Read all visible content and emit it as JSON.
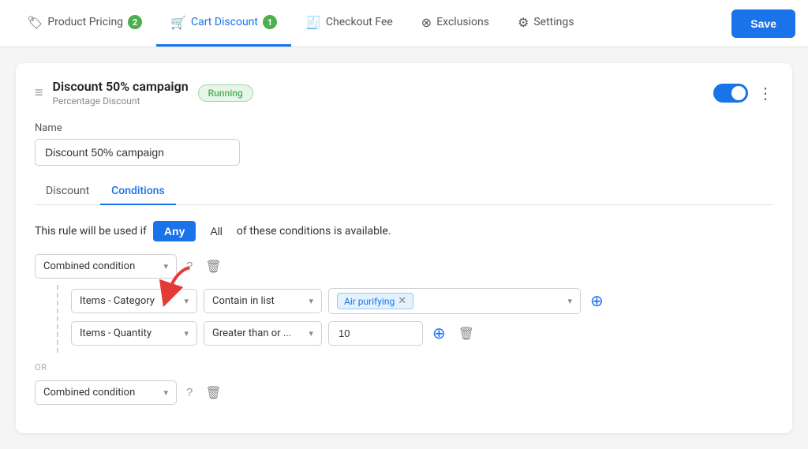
{
  "nav": {
    "tabs": [
      {
        "id": "product-pricing",
        "label": "Product Pricing",
        "icon": "🏷",
        "badge": "2",
        "active": false
      },
      {
        "id": "cart-discount",
        "label": "Cart Discount",
        "icon": "🛒",
        "badge": "1",
        "active": true
      },
      {
        "id": "checkout-fee",
        "label": "Checkout Fee",
        "icon": "🧾",
        "badge": null,
        "active": false
      },
      {
        "id": "exclusions",
        "label": "Exclusions",
        "icon": "⊗",
        "badge": null,
        "active": false
      },
      {
        "id": "settings",
        "label": "Settings",
        "icon": "⚙",
        "badge": null,
        "active": false
      }
    ],
    "save_label": "Save"
  },
  "card": {
    "title": "Discount 50% campaign",
    "subtitle": "Percentage Discount",
    "status": "Running",
    "toggle_on": true
  },
  "form": {
    "name_label": "Name",
    "name_value": "Discount 50% campaign"
  },
  "sub_tabs": [
    {
      "id": "discount",
      "label": "Discount",
      "active": false
    },
    {
      "id": "conditions",
      "label": "Conditions",
      "active": true
    }
  ],
  "conditions": {
    "rule_prefix": "This rule will be used if",
    "any_label": "Any",
    "all_label": "All",
    "rule_suffix": "of these conditions is available.",
    "combined_label": "Combined condition",
    "or_label": "OR",
    "sub_conditions": [
      {
        "field": "Items - Category",
        "operator": "Contain in list",
        "value_type": "tag",
        "value": "Air purifying"
      },
      {
        "field": "Items - Quantity",
        "operator": "Greater than or ...",
        "value_type": "number",
        "value": "10"
      }
    ],
    "combined2_label": "Combined condition",
    "help_label": "?",
    "delete_label": "🗑",
    "add_label": "⊕"
  }
}
